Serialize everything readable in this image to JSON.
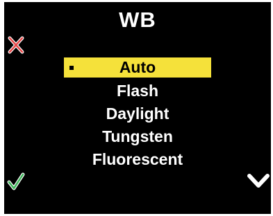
{
  "header": {
    "title": "WB"
  },
  "menu": {
    "items": [
      {
        "label": "Auto",
        "selected": true
      },
      {
        "label": "Flash",
        "selected": false
      },
      {
        "label": "Daylight",
        "selected": false
      },
      {
        "label": "Tungsten",
        "selected": false
      },
      {
        "label": "Fluorescent",
        "selected": false
      }
    ]
  },
  "icons": {
    "close": "close-icon",
    "confirm": "checkmark-icon",
    "down": "chevron-down-icon"
  },
  "colors": {
    "background": "#000000",
    "selection": "#f5e13a",
    "close": "#e84a4a",
    "confirm": "#3fb55a",
    "text": "#ffffff"
  }
}
